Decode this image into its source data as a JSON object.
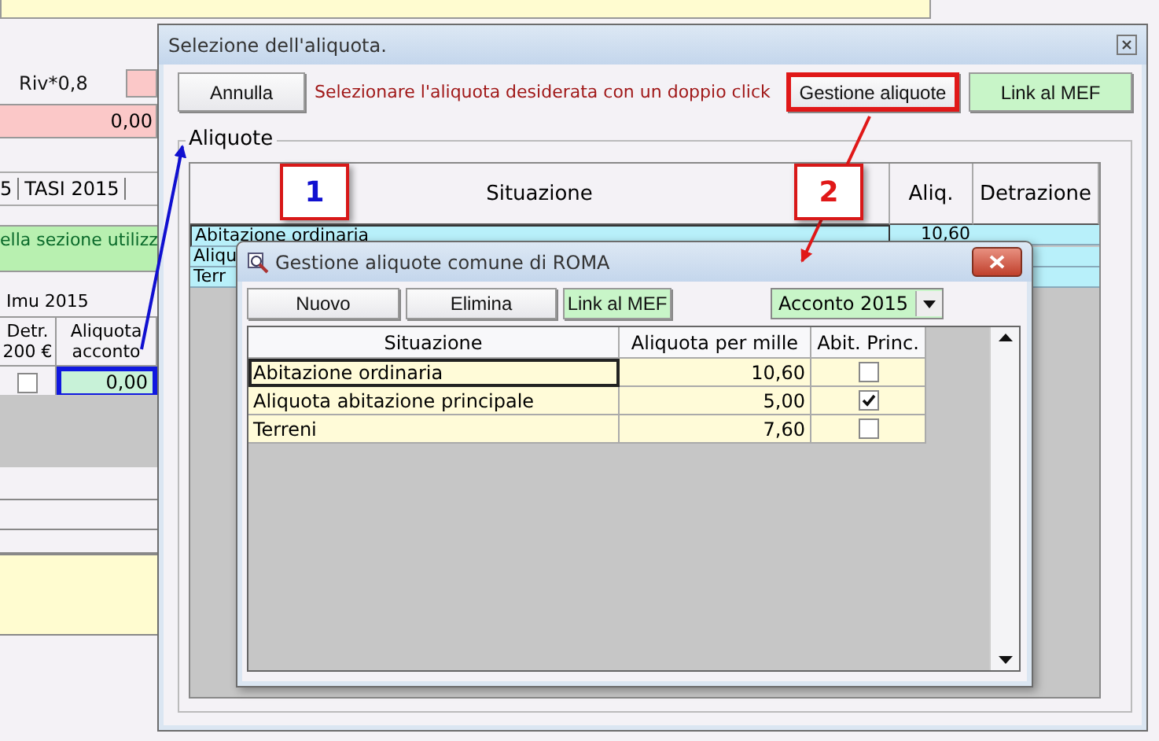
{
  "background_app": {
    "label": "Riv*0,8",
    "amount": "0,00",
    "tabs": [
      "5",
      "TASI 2015"
    ],
    "notice": "ella sezione utilizz",
    "table": {
      "title": "Imu 2015",
      "columns": [
        "Detr. 200 €",
        "Aliquota acconto"
      ],
      "rows": [
        {
          "checked": false,
          "value": "0,00",
          "selected": true
        }
      ]
    }
  },
  "selection_dialog": {
    "title": "Selezione dell'aliquota.",
    "buttons": [
      {
        "label": "Annulla",
        "kind": "plain",
        "highlighted": false
      },
      {
        "label": "Gestione aliquote",
        "kind": "plain",
        "highlighted": true
      },
      {
        "label": "Link al MEF",
        "kind": "green",
        "highlighted": false
      }
    ],
    "message": "Selezionare l'aliquota desiderata con un doppio click",
    "group_title": "Aliquote",
    "table": {
      "columns": [
        "Situazione",
        "Aliq.",
        "Detrazione"
      ],
      "rows": [
        {
          "situazione": "Abitazione ordinaria",
          "aliquota": "10,60"
        },
        {
          "situazione": "Aliqu",
          "aliquota": ""
        },
        {
          "situazione": "Terr",
          "aliquota": ""
        }
      ]
    }
  },
  "management_dialog": {
    "title": "Gestione aliquote comune di ROMA",
    "buttons": [
      {
        "label": "Nuovo",
        "kind": "plain"
      },
      {
        "label": "Elimina",
        "kind": "plain"
      },
      {
        "label": "Link al MEF",
        "kind": "green"
      }
    ],
    "period": "Acconto 2015",
    "table": {
      "columns": [
        "Situazione",
        "Aliquota per mille",
        "Abit. Princ."
      ],
      "rows": [
        {
          "situazione": "Abitazione ordinaria",
          "aliquota": "10,60",
          "checked": false,
          "selected": true
        },
        {
          "situazione": "Aliquota abitazione principale",
          "aliquota": "5,00",
          "checked": true,
          "selected": false
        },
        {
          "situazione": "Terreni",
          "aliquota": "7,60",
          "checked": false,
          "selected": false
        }
      ]
    }
  },
  "callouts": [
    {
      "label": "1",
      "color": "#1010d0"
    },
    {
      "label": "2",
      "color": "#e01818"
    }
  ]
}
